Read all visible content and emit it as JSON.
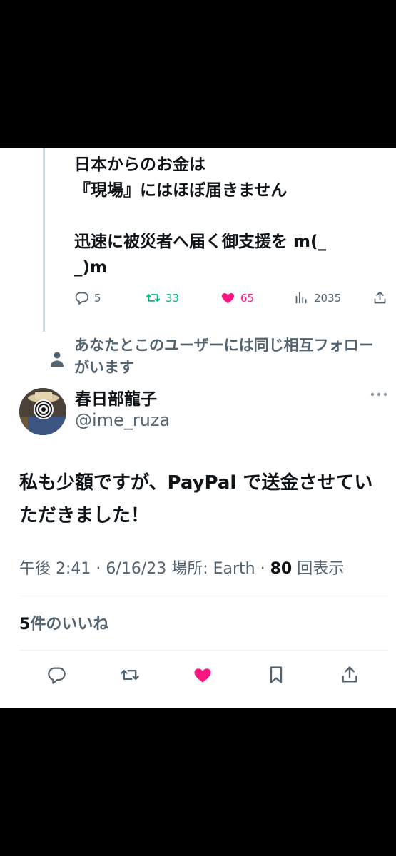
{
  "previous_tweet": {
    "lines": [
      "日本からのお金は",
      "『現場』にはほぼ届きません",
      "",
      "迅速に被災者へ届く御支援を m(_",
      "_)m"
    ],
    "replies": "5",
    "retweets": "33",
    "likes": "65",
    "views": "2035"
  },
  "social_context": "あなたとこのユーザーには同じ相互フォローがいます",
  "tweet": {
    "display_name": "春日部龍子",
    "handle": "@ime_ruza",
    "text": "私も少額ですが、PayPal で送金させていただきました！",
    "time": "午後 2:41",
    "date": "6/16/23",
    "location_label": "場所: Earth",
    "views_count": "80",
    "views_label": "回表示",
    "likes_count": "5",
    "likes_label": "件のいいね"
  },
  "colors": {
    "retweet": "#00ba7c",
    "like": "#f91880",
    "secondary": "#536471"
  }
}
